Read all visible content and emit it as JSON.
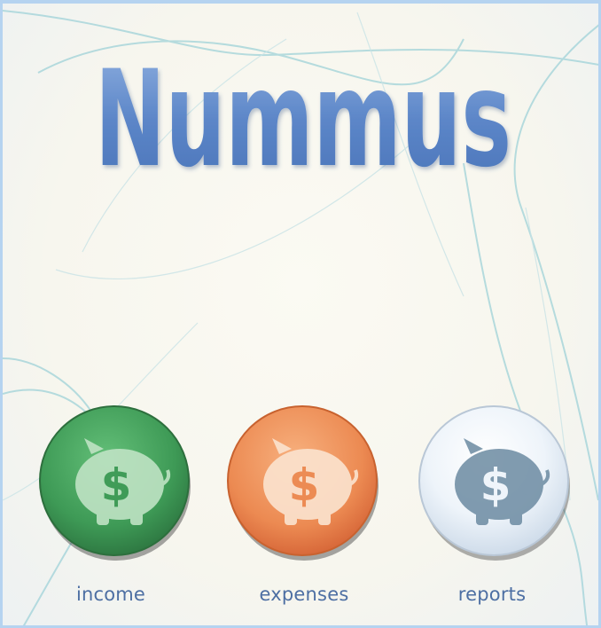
{
  "app": {
    "logo_text": "Nummus"
  },
  "menu": {
    "items": [
      {
        "id": "income",
        "label": "income",
        "icon": "piggy-bank-icon",
        "color": "#3e9a56"
      },
      {
        "id": "expenses",
        "label": "expenses",
        "icon": "piggy-bank-icon",
        "color": "#ec8a52"
      },
      {
        "id": "reports",
        "label": "reports",
        "icon": "piggy-bank-icon",
        "color": "#e9f1f8"
      }
    ]
  },
  "colors": {
    "accent": "#5c86c8",
    "label": "#4d6fa3",
    "background": "#f8f7ef"
  }
}
